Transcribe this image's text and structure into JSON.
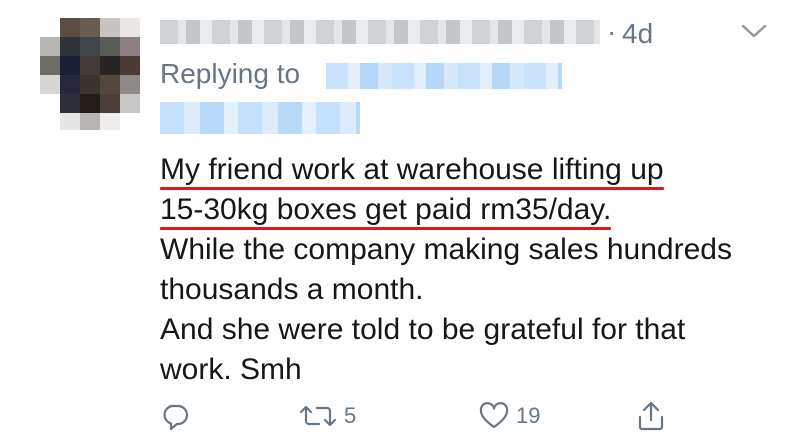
{
  "header": {
    "separator": "·",
    "time": "4d"
  },
  "reply": {
    "label": "Replying to"
  },
  "tweet": {
    "lines": [
      "My friend work at warehouse lifting up",
      "15-30kg boxes  get paid rm35/day.",
      "While the company making sales hundreds",
      "thousands a month.",
      "And she were told to be grateful for that",
      "work. Smh"
    ]
  },
  "actions": {
    "retweet_count": "5",
    "like_count": "19"
  },
  "icons": {
    "reply": "comment-icon",
    "retweet": "retweet-icon",
    "like": "heart-icon",
    "share": "share-icon",
    "menu": "chevron-down-icon"
  },
  "colors": {
    "text": "#14171a",
    "secondary": "#657786",
    "annotation_underline": "#e0161b"
  }
}
